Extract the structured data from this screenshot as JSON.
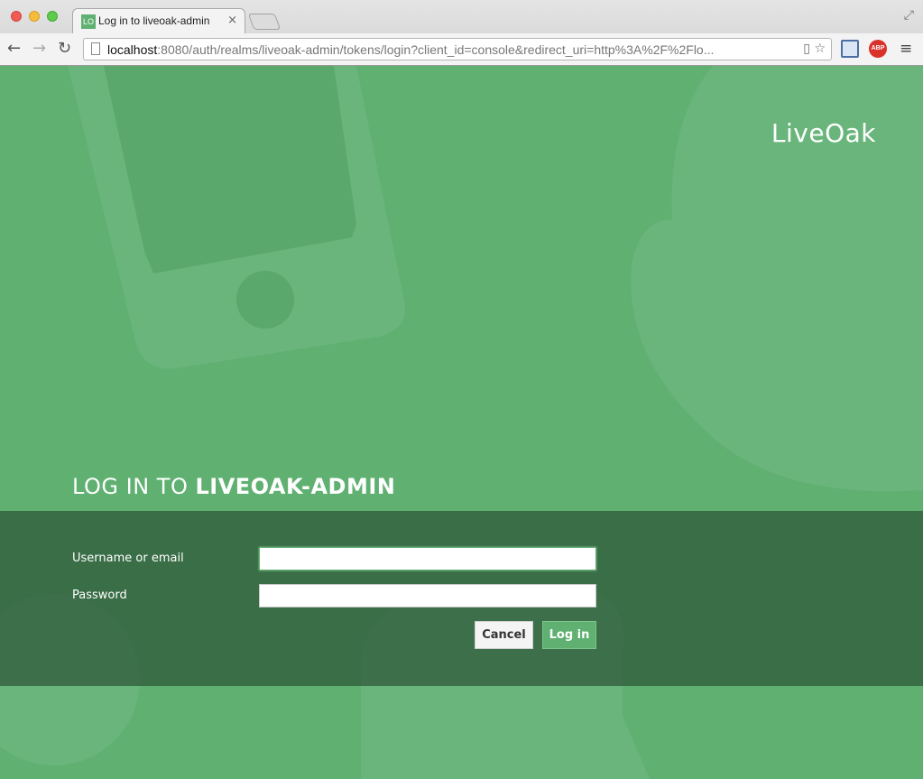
{
  "browser": {
    "tab_title": "Log in to liveoak-admin",
    "tab_favicon": "LO",
    "tab_close": "×",
    "url_host": "localhost",
    "url_rest": ":8080/auth/realms/liveoak-admin/tokens/login?client_id=console&redirect_uri=http%3A%2F%2Flo...",
    "icons": [
      "back-arrow-icon",
      "forward-arrow-icon",
      "reload-icon",
      "page-icon",
      "reader-icon",
      "star-icon",
      "extension-icon",
      "adblock-plus-icon",
      "menu-icon",
      "fullscreen-icon"
    ],
    "abp_label": "ABP"
  },
  "page": {
    "brand": "LiveOak",
    "title_prefix": "LOG IN TO ",
    "title_realm": "LIVEOAK-ADMIN",
    "form": {
      "username_label": "Username or email",
      "username_value": "",
      "password_label": "Password",
      "password_value": "",
      "cancel_label": "Cancel",
      "login_label": "Log in"
    }
  },
  "colors": {
    "background": "#5fb071",
    "form_band": "#3b6b46",
    "login_button": "#5fb071"
  }
}
